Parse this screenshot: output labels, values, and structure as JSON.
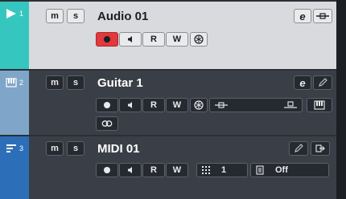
{
  "tracks": [
    {
      "number": "1",
      "name": "Audio 01",
      "mute": "m",
      "solo": "s",
      "read": "R",
      "write": "W",
      "edit": "e"
    },
    {
      "number": "2",
      "name": "Guitar 1",
      "mute": "m",
      "solo": "s",
      "read": "R",
      "write": "W",
      "edit": "e"
    },
    {
      "number": "3",
      "name": "MIDI 01",
      "mute": "m",
      "solo": "s",
      "read": "R",
      "write": "W",
      "channel": "1",
      "output": "Off"
    }
  ],
  "colors": {
    "audio_strip": "#35c6c0",
    "guitar_strip": "#7fa6c9",
    "midi_strip": "#2c6fb8",
    "record_active": "#e0393e"
  }
}
